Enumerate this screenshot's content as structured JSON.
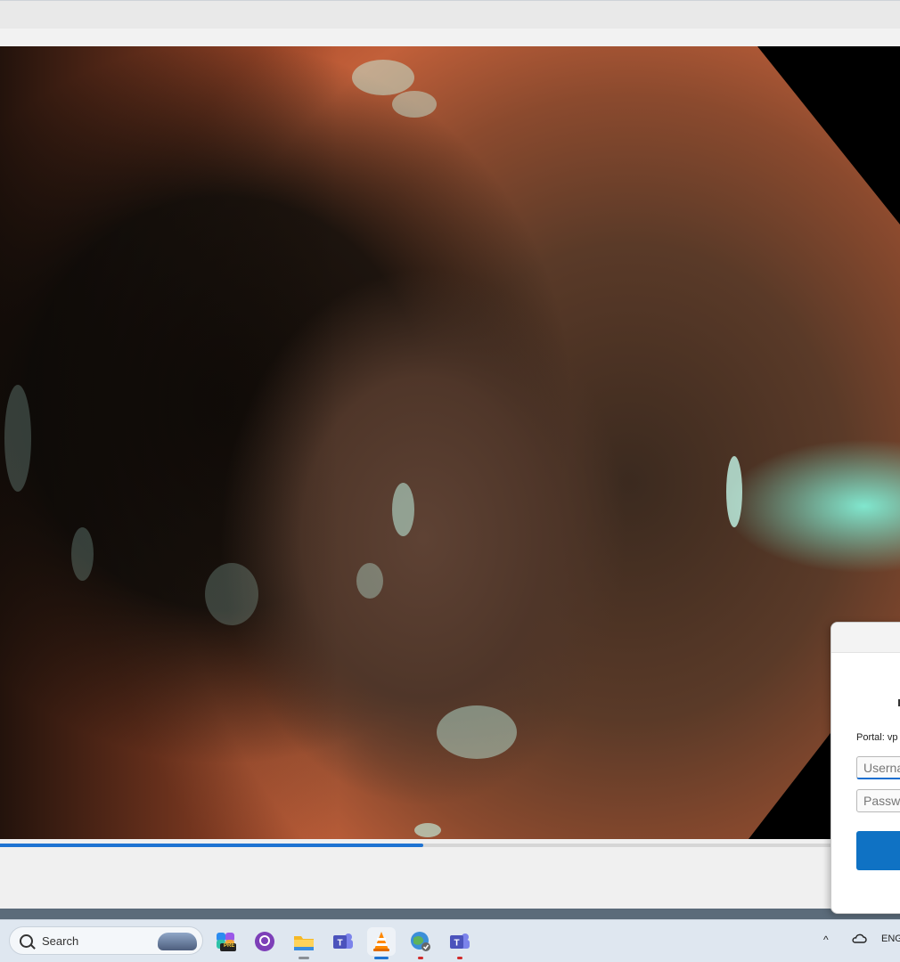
{
  "player": {
    "progress_fraction": 0.47
  },
  "taskbar": {
    "search_label": "Search",
    "apps": [
      {
        "icon": "copilot-pre-icon",
        "badge": "PRE"
      },
      {
        "icon": "github-icon"
      },
      {
        "icon": "file-explorer-icon"
      },
      {
        "icon": "teams-icon"
      },
      {
        "icon": "vlc-icon"
      },
      {
        "icon": "globe-vpn-icon"
      },
      {
        "icon": "teams-work-icon"
      }
    ],
    "tray": {
      "chevron": "^",
      "language": "ENG"
    }
  },
  "dialog": {
    "portal_label": "Portal: vp",
    "username_placeholder": "Userna",
    "password_placeholder": "Passwo"
  },
  "colors": {
    "accent": "#1e73d2",
    "dialog_button": "#0f72c4",
    "taskbar": "#dfe7f0"
  }
}
